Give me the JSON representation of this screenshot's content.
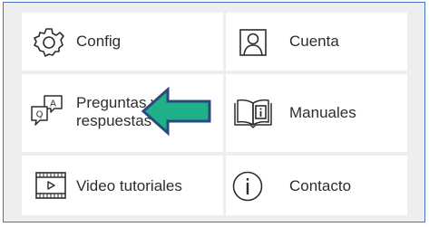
{
  "menu": {
    "config_label": "Config",
    "cuenta_label": "Cuenta",
    "preguntas_line1": "Preguntas y",
    "preguntas_line2": "respuestas",
    "manuales_label": "Manuales",
    "video_label": "Video tutoriales",
    "contacto_label": "Contacto"
  },
  "icons": {
    "config": "gear-icon",
    "cuenta": "user-portrait-icon",
    "preguntas": "qa-bubbles-icon",
    "manuales": "open-book-info-icon",
    "video": "video-player-icon",
    "contacto": "info-circle-icon"
  },
  "colors": {
    "frame_border": "#4472c4",
    "background": "#eeeeee",
    "tile": "#ffffff",
    "arrow_fill": "#1fb08a",
    "arrow_stroke": "#2a4a7f",
    "text": "#2d2d2d"
  }
}
